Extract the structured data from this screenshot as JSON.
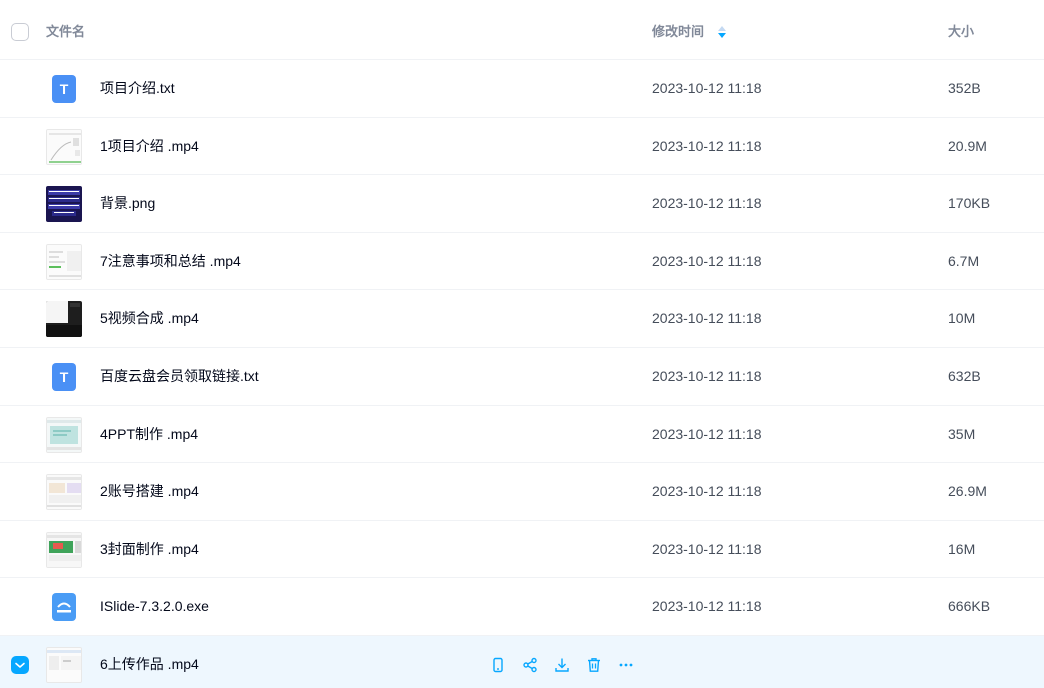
{
  "header": {
    "name_label": "文件名",
    "time_label": "修改时间",
    "size_label": "大小"
  },
  "files": [
    {
      "name": "项目介绍.txt",
      "time": "2023-10-12 11:18",
      "size": "352B",
      "icon": "txt-file-icon"
    },
    {
      "name": "1项目介绍 .mp4",
      "time": "2023-10-12 11:18",
      "size": "20.9M",
      "icon": "video-thumbnail"
    },
    {
      "name": "背景.png",
      "time": "2023-10-12 11:18",
      "size": "170KB",
      "icon": "image-thumbnail"
    },
    {
      "name": "7注意事项和总结 .mp4",
      "time": "2023-10-12 11:18",
      "size": "6.7M",
      "icon": "video-thumbnail"
    },
    {
      "name": "5视频合成 .mp4",
      "time": "2023-10-12 11:18",
      "size": "10M",
      "icon": "video-thumbnail"
    },
    {
      "name": "百度云盘会员领取链接.txt",
      "time": "2023-10-12 11:18",
      "size": "632B",
      "icon": "txt-file-icon"
    },
    {
      "name": "4PPT制作 .mp4",
      "time": "2023-10-12 11:18",
      "size": "35M",
      "icon": "video-thumbnail"
    },
    {
      "name": "2账号搭建 .mp4",
      "time": "2023-10-12 11:18",
      "size": "26.9M",
      "icon": "video-thumbnail"
    },
    {
      "name": "3封面制作 .mp4",
      "time": "2023-10-12 11:18",
      "size": "16M",
      "icon": "video-thumbnail"
    },
    {
      "name": "ISlide-7.3.2.0.exe",
      "time": "2023-10-12 11:18",
      "size": "666KB",
      "icon": "exe-file-icon"
    },
    {
      "name": "6上传作品 .mp4",
      "time": "",
      "size": "",
      "icon": "video-thumbnail",
      "selected": true
    }
  ],
  "actions": [
    "phone-icon",
    "share-icon",
    "download-icon",
    "trash-icon",
    "more-icon"
  ],
  "colors": {
    "accent": "#06a7ff",
    "selected_row_bg": "#eef7fe",
    "header_text": "#818999",
    "txt_icon": "#4a90f5"
  }
}
